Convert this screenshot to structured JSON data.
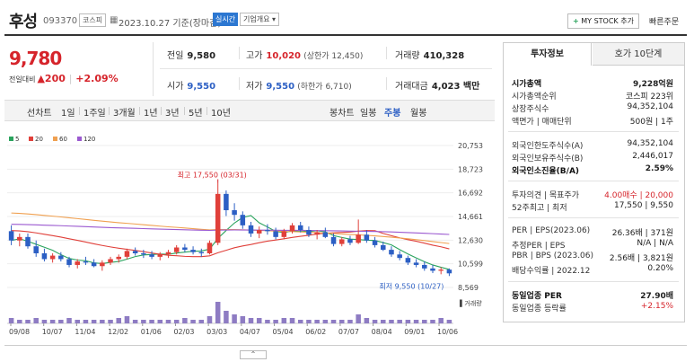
{
  "header": {
    "stock_name": "후성",
    "stock_code": "093370",
    "market_tag": "코스피",
    "date_text": "2023.10.27 기준(장마감)",
    "realtime_btn": "실시간",
    "overview_btn": "기업개요",
    "mystock_btn": "MY STOCK 추가",
    "quick_order": "빠른주문"
  },
  "quote": {
    "price": "9,780",
    "change_label": "전일대비",
    "change_amount": "▲200",
    "change_pct": "+2.09%",
    "prev_close_label": "전일",
    "prev_close": "9,580",
    "high_label": "고가",
    "high": "10,020",
    "upper_limit": "(상한가 12,450)",
    "volume_label": "거래량",
    "volume": "410,328",
    "open_label": "시가",
    "open": "9,550",
    "low_label": "저가",
    "low": "9,550",
    "lower_limit": "(하한가 6,710)",
    "value_label": "거래대금",
    "value": "4,023 백만"
  },
  "chart_tabs": {
    "line_label": "선차트",
    "line_periods": [
      "1일",
      "1주일",
      "3개월",
      "1년",
      "3년",
      "5년",
      "10년"
    ],
    "candle_label": "봉차트",
    "candle_periods": [
      "일봉",
      "주봉",
      "월봉"
    ],
    "selected_candle": "주봉"
  },
  "chart_data": {
    "type": "candlestick",
    "ma_legend": [
      {
        "name": "5",
        "color": "#2aa35d"
      },
      {
        "name": "20",
        "color": "#e0403a"
      },
      {
        "name": "60",
        "color": "#f0a050"
      },
      {
        "name": "120",
        "color": "#9b59d0"
      }
    ],
    "y_ticks": [
      "20,753",
      "18,723",
      "16,692",
      "14,661",
      "12,630",
      "10,599",
      "8,569"
    ],
    "x_ticks": [
      "09/08",
      "10/07",
      "11/04",
      "12/02",
      "01/06",
      "02/03",
      "03/03",
      "04/07",
      "05/04",
      "06/02",
      "07/07",
      "08/04",
      "09/01",
      "10/06"
    ],
    "ylim": [
      8569,
      20753
    ],
    "max_annotation": "최고 17,550 (03/31)",
    "min_annotation": "최저 9,550 (10/27)",
    "volume_label": "거래량",
    "candles": [
      [
        13400,
        13900,
        12200,
        12600
      ],
      [
        12600,
        13200,
        12100,
        12900
      ],
      [
        12900,
        13200,
        11900,
        12100
      ],
      [
        12100,
        12600,
        11200,
        11500
      ],
      [
        11500,
        11900,
        10800,
        11000
      ],
      [
        11000,
        11500,
        10700,
        11300
      ],
      [
        11300,
        11600,
        10800,
        11000
      ],
      [
        11000,
        11200,
        10300,
        10500
      ],
      [
        10500,
        11000,
        10200,
        10800
      ],
      [
        10800,
        11200,
        10500,
        10700
      ],
      [
        10700,
        11000,
        10300,
        10400
      ],
      [
        10400,
        10900,
        10000,
        10700
      ],
      [
        10700,
        11200,
        10500,
        11000
      ],
      [
        11000,
        11400,
        10700,
        11200
      ],
      [
        11200,
        11900,
        11000,
        11700
      ],
      [
        11700,
        12000,
        11300,
        11500
      ],
      [
        11500,
        11800,
        11100,
        11400
      ],
      [
        11400,
        11700,
        11000,
        11200
      ],
      [
        11200,
        11600,
        10900,
        11400
      ],
      [
        11400,
        11800,
        11100,
        11600
      ],
      [
        11600,
        12200,
        11400,
        12000
      ],
      [
        12000,
        12300,
        11600,
        11800
      ],
      [
        11800,
        12100,
        11400,
        11600
      ],
      [
        11600,
        11900,
        11200,
        11500
      ],
      [
        11500,
        12600,
        11400,
        12400
      ],
      [
        12400,
        17550,
        12200,
        16600
      ],
      [
        16600,
        16900,
        14700,
        15200
      ],
      [
        15200,
        15800,
        14300,
        14800
      ],
      [
        14800,
        15100,
        13600,
        13900
      ],
      [
        13900,
        14200,
        12900,
        13200
      ],
      [
        13200,
        13800,
        12800,
        13500
      ],
      [
        13500,
        14000,
        13100,
        13400
      ],
      [
        13400,
        13700,
        12700,
        12900
      ],
      [
        12900,
        13600,
        12700,
        13400
      ],
      [
        13400,
        14100,
        13200,
        13900
      ],
      [
        13900,
        14200,
        13300,
        13500
      ],
      [
        13500,
        13800,
        12900,
        13100
      ],
      [
        13100,
        13500,
        12700,
        13300
      ],
      [
        13300,
        13700,
        12800,
        12900
      ],
      [
        12900,
        13200,
        12100,
        12300
      ],
      [
        12300,
        12900,
        12100,
        12700
      ],
      [
        12700,
        13000,
        12200,
        12400
      ],
      [
        12400,
        14400,
        12300,
        13100
      ],
      [
        13100,
        13500,
        12400,
        12600
      ],
      [
        12600,
        12900,
        12000,
        12200
      ],
      [
        12200,
        12500,
        11700,
        11800
      ],
      [
        11800,
        12100,
        11200,
        11400
      ],
      [
        11400,
        11700,
        10900,
        11100
      ],
      [
        11100,
        11300,
        10500,
        10700
      ],
      [
        10700,
        11000,
        10300,
        10500
      ],
      [
        10500,
        10800,
        10000,
        10200
      ],
      [
        10200,
        10500,
        9800,
        10000
      ],
      [
        10000,
        10300,
        9700,
        10100
      ],
      [
        10100,
        10200,
        9550,
        9780
      ]
    ],
    "volumes": [
      3,
      2,
      2,
      3,
      2,
      2,
      2,
      3,
      2,
      2,
      2,
      2,
      2,
      3,
      4,
      2,
      2,
      2,
      2,
      2,
      2,
      3,
      2,
      2,
      4,
      12,
      7,
      5,
      4,
      3,
      3,
      2,
      2,
      3,
      3,
      2,
      2,
      2,
      2,
      2,
      2,
      2,
      5,
      3,
      2,
      2,
      2,
      2,
      2,
      2,
      2,
      2,
      3,
      2
    ]
  },
  "investment": {
    "tab_info": "투자정보",
    "tab_orderbook": "호가 10단계",
    "rows": [
      {
        "label": "시가총액",
        "value": "9,228억원",
        "bold": true
      },
      {
        "label": "시가총액순위",
        "value": "코스피 223위"
      },
      {
        "label": "상장주식수",
        "value": "94,352,104"
      },
      {
        "label": "액면가 | 매매단위",
        "value": "500원 | 1주"
      },
      {
        "label": "외국인한도주식수(A)",
        "value": "94,352,104"
      },
      {
        "label": "외국인보유주식수(B)",
        "value": "2,446,017"
      },
      {
        "label": "외국인소진율(B/A)",
        "value": "2.59%",
        "bold": true
      },
      {
        "label": "투자의견 | 목표주가",
        "value": "4.00매수 | 20,000"
      },
      {
        "label": "52주최고 | 최저",
        "value": "17,550 | 9,550"
      },
      {
        "label": "PER | EPS(2023.06)",
        "value": "26.36배 | 371원"
      },
      {
        "label": "추정PER | EPS",
        "value": "N/A | N/A"
      },
      {
        "label": "PBR | BPS (2023.06)",
        "value": "2.56배 | 3,821원"
      },
      {
        "label": "배당수익률 | 2022.12",
        "value": "0.20%"
      },
      {
        "label": "동일업종 PER",
        "value": "27.90배",
        "bold": true
      },
      {
        "label": "동일업종 등락률",
        "value": "+2.15%"
      }
    ]
  },
  "colors": {
    "up": "#d6242b",
    "down": "#2c5fc4",
    "accent": "#2c77d1"
  }
}
